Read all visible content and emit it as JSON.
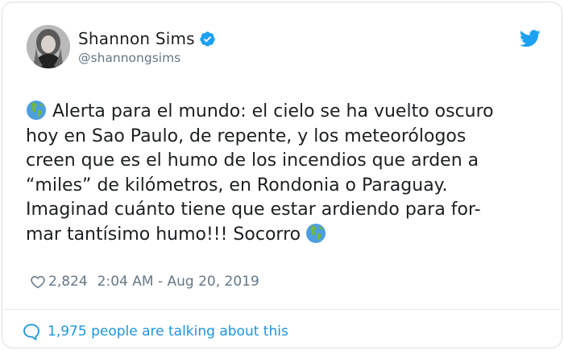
{
  "author": {
    "name": "Shannon Sims",
    "handle": "@shannongsims",
    "verified": true
  },
  "tweet": {
    "text": "Alerta para el mundo: el cielo se ha vuelto oscuro\nhoy en Sao Paulo, de repente, y los meteorólogos\ncreen que es el humo de los incendios que arden a\n“miles” de kilómetros, en Rondonia o Paraguay.\nImaginad cuánto tiene que estar ardiendo para for-\nmar tantísimo humo!!! Socorro",
    "leading_emoji": "globe-icon",
    "trailing_emoji": "globe-icon"
  },
  "meta": {
    "likes": "2,824",
    "timestamp": "2:04 AM - Aug 20, 2019"
  },
  "footer": {
    "talking": "1,975 people are talking about this"
  },
  "colors": {
    "brand_blue": "#1da1f2",
    "link_blue": "#1b95e0",
    "secondary_text": "#657786"
  }
}
